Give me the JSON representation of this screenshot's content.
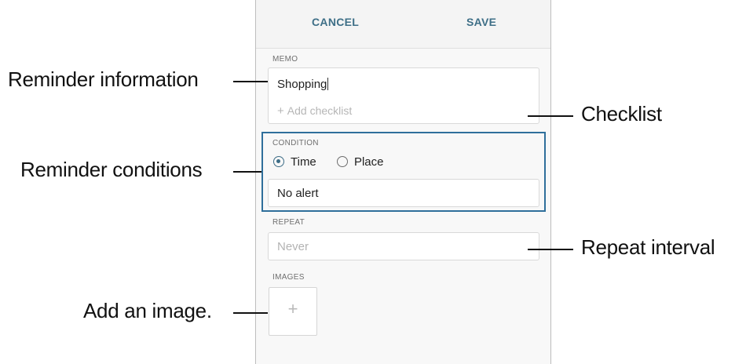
{
  "header": {
    "cancel_label": "CANCEL",
    "save_label": "SAVE"
  },
  "memo": {
    "label": "MEMO",
    "text": "Shopping",
    "add_checklist": "Add checklist",
    "add_checklist_icon": "plus-icon"
  },
  "condition": {
    "label": "CONDITION",
    "options": [
      {
        "label": "Time",
        "selected": true
      },
      {
        "label": "Place",
        "selected": false
      }
    ],
    "alert_value": "No alert"
  },
  "repeat": {
    "label": "REPEAT",
    "placeholder": "Never"
  },
  "images": {
    "label": "IMAGES",
    "add_icon": "plus-icon"
  },
  "callouts": {
    "reminder_information": "Reminder information",
    "reminder_conditions": "Reminder conditions",
    "add_image": "Add an image.",
    "checklist": "Checklist",
    "repeat_interval": "Repeat interval"
  },
  "colors": {
    "accent": "#3e6f87",
    "highlight": "#2f6f9b"
  }
}
